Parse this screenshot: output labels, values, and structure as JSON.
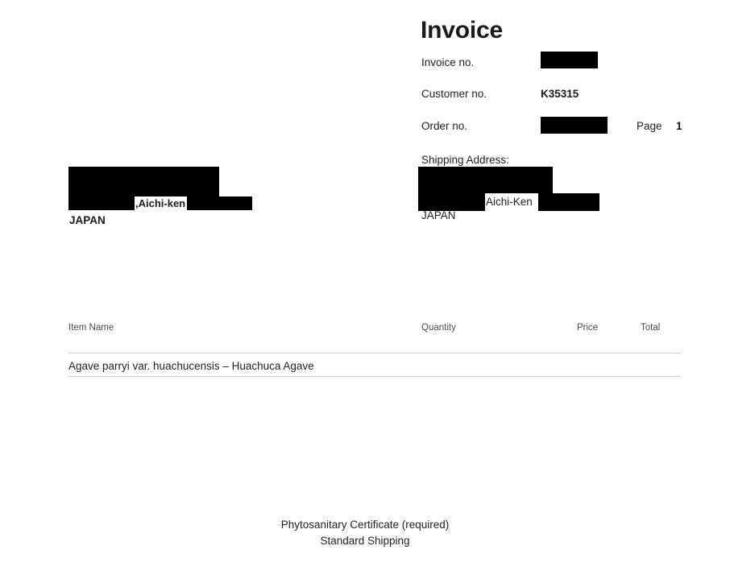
{
  "document": {
    "title": "Invoice"
  },
  "meta": {
    "invoice_no_label": "Invoice no.",
    "invoice_no_value": "",
    "customer_no_label": "Customer no.",
    "customer_no_value": "K35315",
    "order_no_label": "Order no.",
    "order_no_value": "",
    "page_label": "Page",
    "page_number": "1"
  },
  "billing_address": {
    "city_region": ",Aichi-ken",
    "country": "JAPAN"
  },
  "shipping_address": {
    "heading": "Shipping Address:",
    "city_region": "Aichi-Ken",
    "country": "JAPAN"
  },
  "items_table": {
    "columns": {
      "item_name": "Item Name",
      "quantity": "Quantity",
      "price": "Price",
      "total": "Total"
    },
    "rows": [
      {
        "item_name": "Agave parryi var. huachucensis – Huachuca Agave",
        "quantity": "",
        "price": "",
        "total": ""
      }
    ]
  },
  "footer": {
    "line1": "Phytosanitary Certificate (required)",
    "line2": "Standard Shipping"
  },
  "colors": {
    "text": "#231f20",
    "heading": "#1a1a1a",
    "muted": "#4a4a4a",
    "rule": "#cfcfcf",
    "redaction": "#000000",
    "background": "#ffffff"
  }
}
